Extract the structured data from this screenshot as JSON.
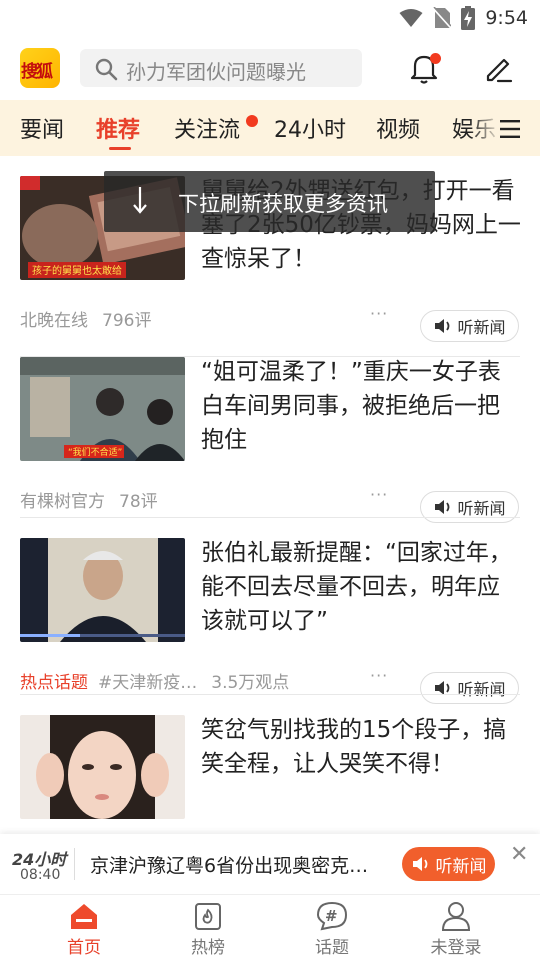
{
  "status_bar": {
    "time": "9:54"
  },
  "header": {
    "logo_text": "搜狐",
    "search_placeholder": "孙力军团伙问题曝光"
  },
  "tabs": [
    {
      "label": "要闻"
    },
    {
      "label": "推荐",
      "active": true
    },
    {
      "label": "关注流",
      "has_dot": true
    },
    {
      "label": "24小时"
    },
    {
      "label": "视频"
    },
    {
      "label": "娱乐"
    }
  ],
  "toast": {
    "text": "下拉刷新获取更多资讯"
  },
  "feed": [
    {
      "title": "舅舅给2外甥送红包，打开一看塞了2张50亿钞票，妈妈网上一查惊呆了！",
      "source": "北晚在线",
      "comments": "796评",
      "more": "···",
      "listen_label": "听新闻",
      "thumb_caption": "孩子的舅舅也太敢给"
    },
    {
      "title": "“姐可温柔了！”重庆一女子表白车间男同事，被拒绝后一把抱住",
      "source": "有棵树官方",
      "comments": "78评",
      "more": "···",
      "listen_label": "听新闻",
      "thumb_caption": "“我们不合适”"
    },
    {
      "title": "张伯礼最新提醒：“回家过年，能不回去尽量不回去，明年应该就可以了”",
      "hot_label": "热点话题",
      "topic": "#天津新疫…",
      "views": "3.5万观点",
      "more": "···",
      "listen_label": "听新闻"
    },
    {
      "title": "笑岔气别找我的15个段子，搞笑全程，让人哭笑不得！"
    }
  ],
  "player": {
    "badge": "24小时",
    "time": "08:40",
    "title": "京津沪豫辽粤6省份出现奥密克…",
    "button_label": "听新闻",
    "close": "✕"
  },
  "bottom_nav": [
    {
      "label": "首页",
      "icon": "home-icon",
      "active": true
    },
    {
      "label": "热榜",
      "icon": "hot-list-icon"
    },
    {
      "label": "话题",
      "icon": "topic-icon"
    },
    {
      "label": "未登录",
      "icon": "user-icon"
    }
  ],
  "colors": {
    "accent": "#e8402a",
    "tab_bg": "#fdf3df",
    "player_button": "#f15f2c"
  }
}
